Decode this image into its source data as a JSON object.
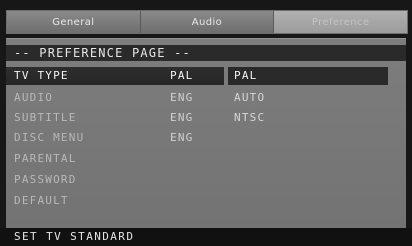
{
  "tabs": [
    {
      "label": "General"
    },
    {
      "label": "Audio"
    },
    {
      "label": "Preference"
    }
  ],
  "page_title": "-- PREFERENCE PAGE --",
  "menu": [
    {
      "label": "TV TYPE",
      "value": "PAL"
    },
    {
      "label": "AUDIO",
      "value": "ENG"
    },
    {
      "label": "SUBTITLE",
      "value": "ENG"
    },
    {
      "label": "DISC MENU",
      "value": "ENG"
    },
    {
      "label": "PARENTAL",
      "value": ""
    },
    {
      "label": "PASSWORD",
      "value": ""
    },
    {
      "label": "DEFAULT",
      "value": ""
    }
  ],
  "options": [
    "PAL",
    "AUTO",
    "NTSC"
  ],
  "status": "SET TV STANDARD"
}
